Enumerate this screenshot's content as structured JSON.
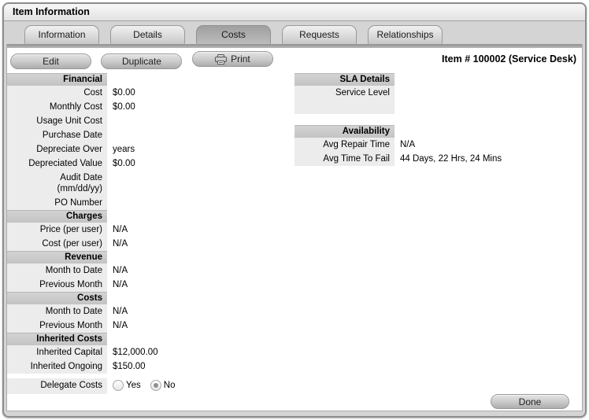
{
  "window_title": "Item Information",
  "tabs": [
    {
      "label": "Information",
      "active": false
    },
    {
      "label": "Details",
      "active": false
    },
    {
      "label": "Costs",
      "active": true
    },
    {
      "label": "Requests",
      "active": false
    },
    {
      "label": "Relationships",
      "active": false
    }
  ],
  "toolbar": {
    "edit_label": "Edit",
    "duplicate_label": "Duplicate",
    "print_label": "Print",
    "item_ref": "Item # 100002 (Service Desk)"
  },
  "left_column": {
    "sections": [
      {
        "header": "Financial",
        "rows": [
          {
            "label": "Cost",
            "value": "$0.00"
          },
          {
            "label": "Monthly Cost",
            "value": "$0.00"
          },
          {
            "label": "Usage Unit Cost",
            "value": ""
          },
          {
            "label": "Purchase Date",
            "value": ""
          },
          {
            "label": "Depreciate Over",
            "value": "years"
          },
          {
            "label": "Depreciated Value",
            "value": "$0.00"
          },
          {
            "label": "Audit Date",
            "sub": "(mm/dd/yy)",
            "value": ""
          },
          {
            "label": "PO Number",
            "value": ""
          }
        ]
      },
      {
        "header": "Charges",
        "rows": [
          {
            "label": "Price (per user)",
            "value": "N/A"
          },
          {
            "label": "Cost (per user)",
            "value": "N/A"
          }
        ]
      },
      {
        "header": "Revenue",
        "rows": [
          {
            "label": "Month to Date",
            "value": "N/A"
          },
          {
            "label": "Previous Month",
            "value": "N/A"
          }
        ]
      },
      {
        "header": "Costs",
        "rows": [
          {
            "label": "Month to Date",
            "value": "N/A"
          },
          {
            "label": "Previous Month",
            "value": "N/A"
          }
        ]
      },
      {
        "header": "Inherited Costs",
        "rows": [
          {
            "label": "Inherited Capital",
            "value": "$12,000.00"
          },
          {
            "label": "Inherited Ongoing",
            "value": "$150.00"
          }
        ]
      }
    ],
    "delegate_costs": {
      "label": "Delegate Costs",
      "options": [
        {
          "label": "Yes",
          "selected": false
        },
        {
          "label": "No",
          "selected": true
        }
      ]
    }
  },
  "right_column": {
    "sections": [
      {
        "header": "SLA Details",
        "rows": [
          {
            "label": "Service Level",
            "value": ""
          }
        ]
      },
      {
        "header": "Availability",
        "rows": [
          {
            "label": "Avg Repair Time",
            "value": "N/A"
          },
          {
            "label": "Avg Time To Fail",
            "value": "44 Days, 22 Hrs, 24 Mins"
          }
        ]
      }
    ]
  },
  "footer": {
    "done_label": "Done"
  },
  "colors": {
    "window_border": "#8c8c8c",
    "tab_area_bg": "#d4d4d4",
    "section_header_bg": "#c9c9c9",
    "label_column_bg": "#ececec"
  }
}
